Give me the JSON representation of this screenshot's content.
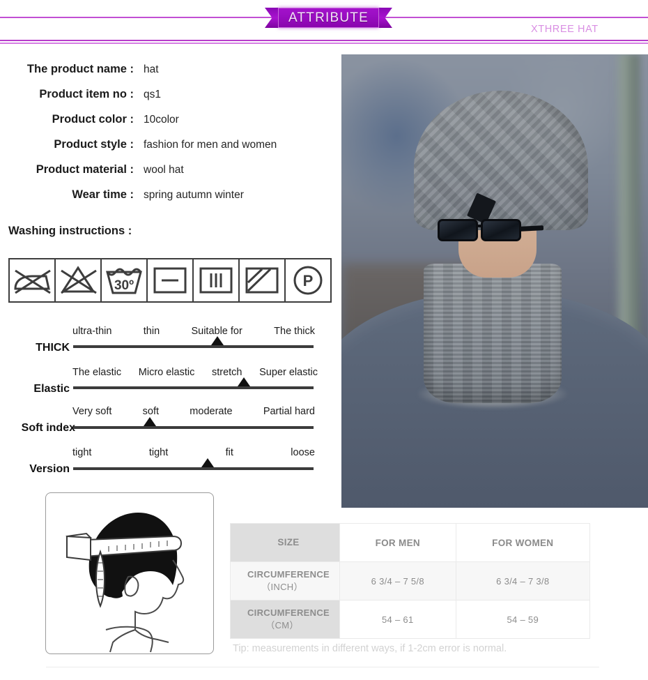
{
  "header": {
    "ribbon_label": "ATTRIBUTE",
    "brand": "XTHREE HAT",
    "accent_color": "#a312cb",
    "brand_color": "#d98fe3"
  },
  "info": {
    "rows": [
      {
        "label": "The product name :",
        "value": "hat"
      },
      {
        "label": "Product item no :",
        "value": "qs1"
      },
      {
        "label": "Product color :",
        "value": "10color"
      },
      {
        "label": "Product style :",
        "value": "fashion for men and women"
      },
      {
        "label": "Product material :",
        "value": "wool hat"
      },
      {
        "label": "Wear time :",
        "value": "spring autumn winter"
      }
    ],
    "washing_title": "Washing instructions :"
  },
  "care_icons": [
    {
      "name": "do-not-iron-icon"
    },
    {
      "name": "do-not-bleach-icon"
    },
    {
      "name": "machine-wash-30-icon",
      "label": "30º"
    },
    {
      "name": "dry-flat-icon"
    },
    {
      "name": "drip-dry-icon"
    },
    {
      "name": "dry-in-shade-icon"
    },
    {
      "name": "dry-clean-p-icon",
      "label": "P"
    }
  ],
  "scales": [
    {
      "name": "THICK",
      "ticks": [
        "ultra-thin",
        "thin",
        "Suitable for",
        "The thick"
      ],
      "selected_index": 2,
      "marker_percent": 60
    },
    {
      "name": "Elastic",
      "ticks": [
        "The elastic",
        "Micro elastic",
        "stretch",
        "Super elastic"
      ],
      "selected_index": 2,
      "marker_percent": 71
    },
    {
      "name": "Soft index",
      "ticks": [
        "Very soft",
        "soft",
        "moderate",
        "Partial hard"
      ],
      "selected_index": 1,
      "marker_percent": 32
    },
    {
      "name": "Version",
      "ticks": [
        "tight",
        "tight",
        "fit",
        "loose"
      ],
      "selected_index": 2,
      "marker_percent": 56
    }
  ],
  "size_table": {
    "headers": [
      "SIZE",
      "FOR MEN",
      "FOR WOMEN"
    ],
    "rows": [
      {
        "label": "CIRCUMFERENCE",
        "sub": "（INCH）",
        "men": "6 3/4 – 7 5/8",
        "women": "6 3/4 – 7 3/8"
      },
      {
        "label": "CIRCUMFERENCE",
        "sub": "（CM）",
        "men": "54 – 61",
        "women": "54 – 59"
      }
    ],
    "tip": "Tip: measurements in different ways, if 1-2cm error is normal."
  },
  "diagram": {
    "name": "head-circumference-measure-diagram"
  },
  "photo": {
    "name": "model-wearing-grey-knit-beanie-and-neck-warmer"
  }
}
